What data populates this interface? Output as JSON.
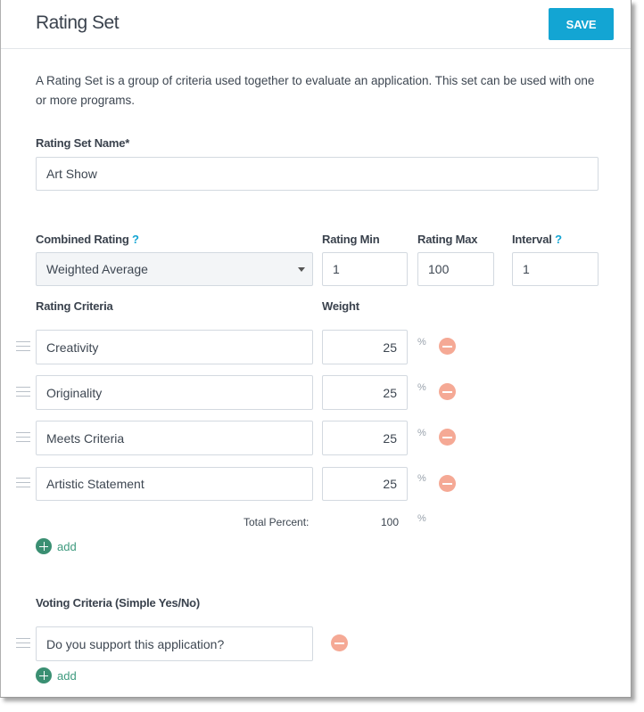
{
  "header": {
    "title": "Rating Set",
    "save_label": "SAVE"
  },
  "description": "A Rating Set is a group of criteria used together to evaluate an application. This set can be used with one or more programs.",
  "name_field": {
    "label": "Rating Set Name*",
    "value": "Art Show"
  },
  "combined_rating": {
    "label": "Combined Rating",
    "help": "?",
    "value": "Weighted Average"
  },
  "rating_min": {
    "label": "Rating Min",
    "value": "1"
  },
  "rating_max": {
    "label": "Rating Max",
    "value": "100"
  },
  "interval": {
    "label": "Interval",
    "help": "?",
    "value": "1"
  },
  "rating_criteria": {
    "label": "Rating Criteria",
    "weight_label": "Weight",
    "unit": "%",
    "items": [
      {
        "name": "Creativity",
        "weight": "25"
      },
      {
        "name": "Originality",
        "weight": "25"
      },
      {
        "name": "Meets Criteria",
        "weight": "25"
      },
      {
        "name": "Artistic Statement",
        "weight": "25"
      }
    ],
    "total_label": "Total Percent:",
    "total_value": "100",
    "add_label": "add"
  },
  "voting_criteria": {
    "label": "Voting Criteria (Simple Yes/No)",
    "items": [
      {
        "question": "Do you support this application?"
      }
    ],
    "add_label": "add"
  },
  "colors": {
    "accent": "#13a5d3",
    "remove": "#f5a995",
    "add": "#3a8f72"
  }
}
